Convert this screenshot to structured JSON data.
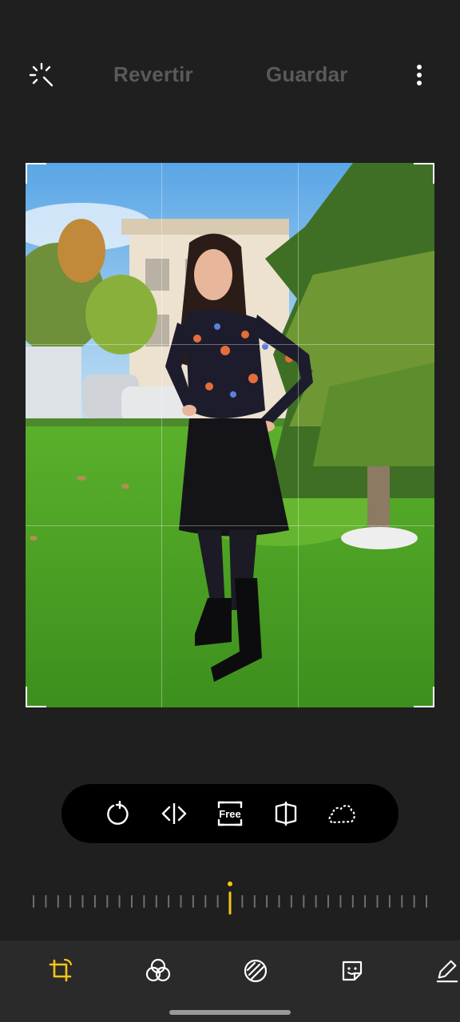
{
  "header": {
    "revert_label": "Revertir",
    "save_label": "Guardar",
    "auto_icon": "magic-wand-icon",
    "more_icon": "more-vertical-icon"
  },
  "photo": {
    "description_icon": "photo-canvas",
    "grid": "3x3"
  },
  "crop_tools": {
    "rotate_icon": "rotate-icon",
    "flip_icon": "flip-horizontal-icon",
    "free_label": "Free",
    "perspective_icon": "perspective-icon",
    "lasso_icon": "lasso-icon"
  },
  "slider": {
    "value": 0,
    "accent": "#f5c518"
  },
  "bottom_nav": {
    "items": [
      "crop-rotate-icon",
      "filters-icon",
      "adjust-icon",
      "sticker-icon",
      "draw-icon"
    ],
    "active": "crop-rotate-icon",
    "accent": "#f5c518"
  }
}
